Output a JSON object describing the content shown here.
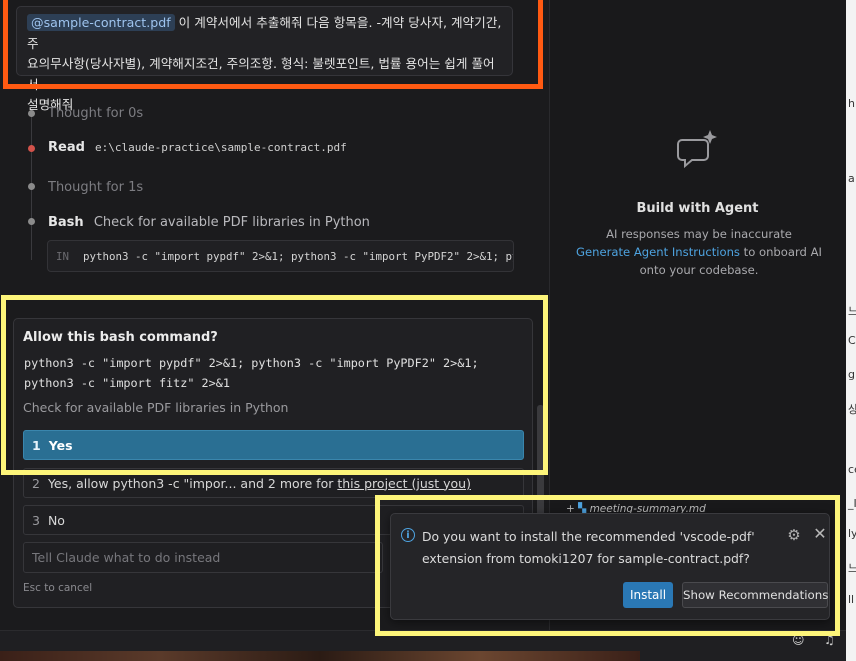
{
  "prompt": {
    "file_mention": "@sample-contract.pdf",
    "line1_rest": " 이 계약서에서 추출해줘 다음 항목을. -계약 당사자, 계약기간, 주",
    "line2": "요의무사항(당사자별), 계약해지조건, 주의조항. 형식: 불렛포인트, 법률 용어는 쉽게 풀어서",
    "line3": "설명해줘"
  },
  "timeline": {
    "thought1": "Thought for 0s",
    "read_label": "Read",
    "read_path": "e:\\claude-practice\\sample-contract.pdf",
    "thought2": "Thought for 1s",
    "bash_label": "Bash",
    "bash_desc": "Check for available PDF libraries in Python",
    "bash_in": "IN",
    "bash_code": "python3 -c \"import pypdf\" 2>&1; python3 -c \"import PyPDF2\" 2>&1; pytho"
  },
  "permission": {
    "title": "Allow this bash command?",
    "cmd_line1": "python3 -c \"import pypdf\" 2>&1; python3 -c \"import PyPDF2\" 2>&1;",
    "cmd_line2": "python3 -c \"import fitz\" 2>&1",
    "description": "Check for available PDF libraries in Python",
    "options": [
      {
        "num": "1",
        "label": "Yes"
      },
      {
        "num": "2",
        "label": "Yes, allow python3 -c \"impor... and 2 more for ",
        "link": "this project (just you)"
      },
      {
        "num": "3",
        "label": "No"
      }
    ],
    "input_placeholder": "Tell Claude what to do instead",
    "esc_hint": "Esc to cancel"
  },
  "agent": {
    "title": "Build with Agent",
    "line1": "AI responses may be inaccurate",
    "link": "Generate Agent Instructions",
    "line2_rest": " to onboard AI",
    "line3": "onto your codebase.",
    "file_row": "meeting-summary.md"
  },
  "notification": {
    "message": "Do you want to install the recommended 'vscode-pdf' extension from tomoki1207 for sample-contract.pdf?",
    "install": "Install",
    "show_recommendations": "Show Recommendations"
  },
  "colors": {
    "accent": "#2a6f93",
    "link": "#4ea3e0",
    "highlight_orange": "#ff5a12",
    "highlight_yellow": "#fdf57a"
  }
}
